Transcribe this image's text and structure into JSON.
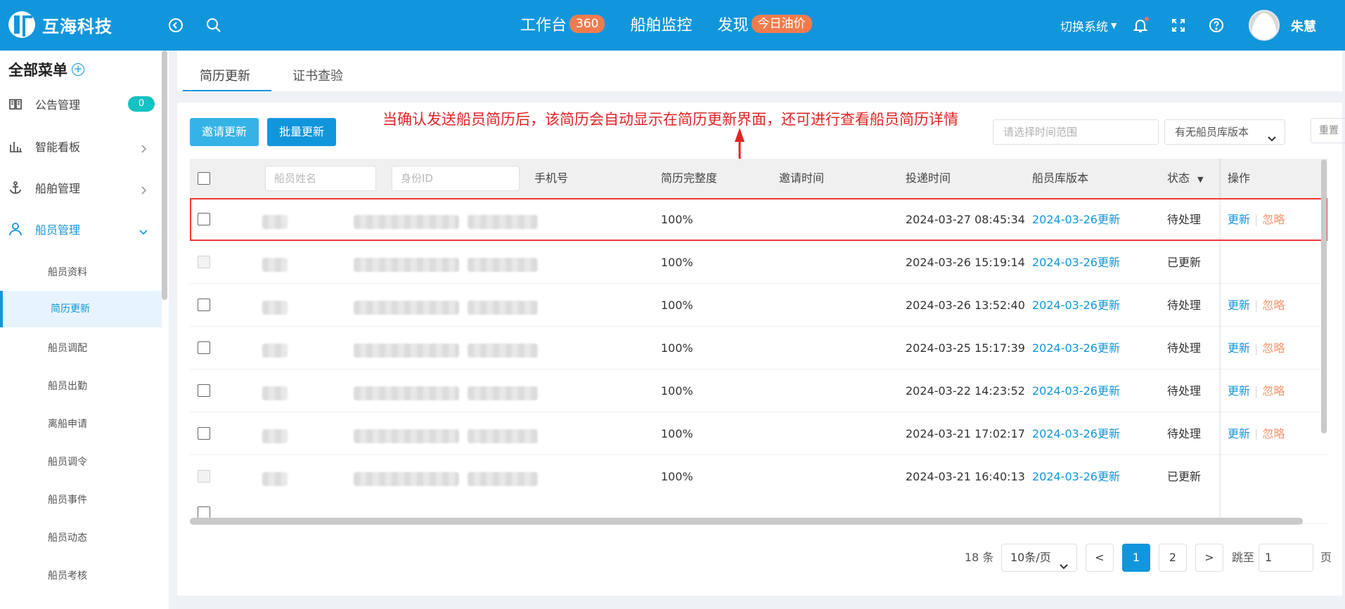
{
  "header": {
    "logo_text": "互海科技",
    "nav": [
      {
        "label": "工作台",
        "badge": "360"
      },
      {
        "label": "船舶监控",
        "badge": ""
      },
      {
        "label": "发现",
        "badge": "今日油价"
      }
    ],
    "switch_system": "切换系统",
    "username": "朱慧"
  },
  "sidebar": {
    "title": "全部菜单",
    "items": [
      {
        "label": "公告管理",
        "badge": "0",
        "icon": "book-icon"
      },
      {
        "label": "智能看板",
        "icon": "bar-chart-icon"
      },
      {
        "label": "船舶管理",
        "icon": "anchor-icon"
      },
      {
        "label": "船员管理",
        "icon": "person-icon"
      }
    ],
    "sub_items": [
      "船员资料",
      "简历更新",
      "船员调配",
      "船员出勤",
      "离船申请",
      "船员调令",
      "船员事件",
      "船员动态",
      "船员考核"
    ],
    "active_sub": "简历更新"
  },
  "tabs": [
    "简历更新",
    "证书查验"
  ],
  "toolbar": {
    "invite_label": "邀请更新",
    "batch_label": "批量更新",
    "annotation": "当确认发送船员简历后，该简历会自动显示在简历更新界面，还可进行查看船员简历详情",
    "date_placeholder": "请选择时间范围",
    "version_select": "有无船员库版本",
    "reset_label": "重置"
  },
  "table": {
    "headers": {
      "name_placeholder": "船员姓名",
      "id_placeholder": "身份ID",
      "phone": "手机号",
      "completeness": "简历完整度",
      "invite_time": "邀请时间",
      "submit_time": "投递时间",
      "version": "船员库版本",
      "status": "状态",
      "ops": "操作"
    },
    "rows": [
      {
        "completeness": "100%",
        "submit_time": "2024-03-27 08:45:34",
        "version": "2024-03-26更新",
        "status": "待处理",
        "update": "更新",
        "ignore": "忽略"
      },
      {
        "completeness": "100%",
        "submit_time": "2024-03-26 15:19:14",
        "version": "2024-03-26更新",
        "status": "已更新",
        "update": "",
        "ignore": ""
      },
      {
        "completeness": "100%",
        "submit_time": "2024-03-26 13:52:40",
        "version": "2024-03-26更新",
        "status": "待处理",
        "update": "更新",
        "ignore": "忽略"
      },
      {
        "completeness": "100%",
        "submit_time": "2024-03-25 15:17:39",
        "version": "2024-03-26更新",
        "status": "待处理",
        "update": "更新",
        "ignore": "忽略"
      },
      {
        "completeness": "100%",
        "submit_time": "2024-03-22 14:23:52",
        "version": "2024-03-26更新",
        "status": "待处理",
        "update": "更新",
        "ignore": "忽略"
      },
      {
        "completeness": "100%",
        "submit_time": "2024-03-21 17:02:17",
        "version": "2024-03-26更新",
        "status": "待处理",
        "update": "更新",
        "ignore": "忽略"
      },
      {
        "completeness": "100%",
        "submit_time": "2024-03-21 16:40:13",
        "version": "2024-03-26更新",
        "status": "已更新",
        "update": "",
        "ignore": ""
      }
    ]
  },
  "pagination": {
    "total": "18 条",
    "page_size": "10条/页",
    "prev": "<",
    "pages": [
      "1",
      "2"
    ],
    "next": ">",
    "goto_label": "跳至",
    "goto_value": "1",
    "page_suffix": "页"
  },
  "colors": {
    "primary": "#1296db",
    "badge": "#f07c4d",
    "annotation": "#e02424",
    "ignore": "#f6956c"
  }
}
